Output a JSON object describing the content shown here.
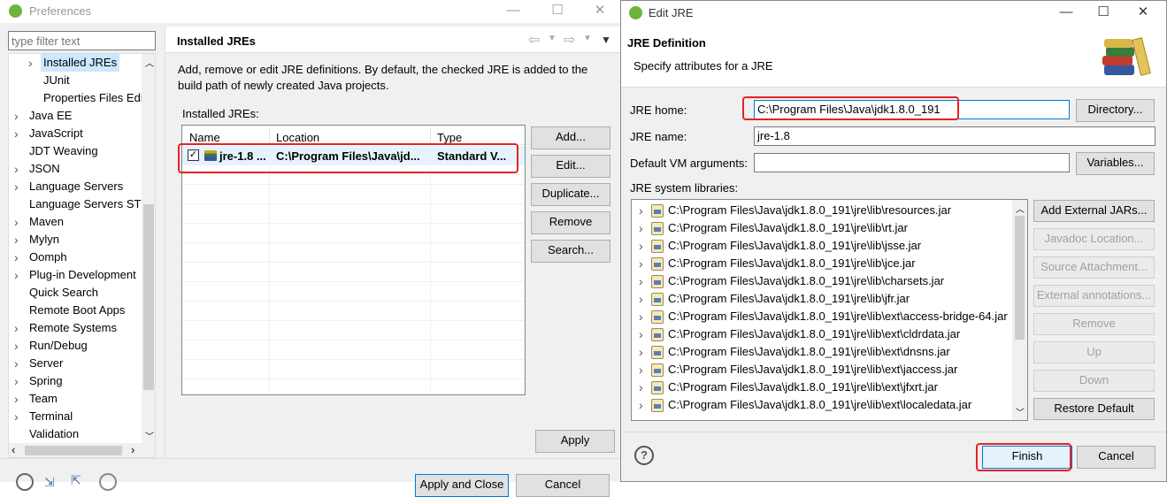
{
  "preferences": {
    "title": "Preferences",
    "filter_placeholder": "type filter text",
    "tree_items": [
      {
        "label": "Installed JREs",
        "expander": "›",
        "selected": true
      },
      {
        "label": "JUnit",
        "expander": "",
        "selected": false
      },
      {
        "label": "Properties Files Edi",
        "expander": "",
        "selected": false
      },
      {
        "label": "Java EE",
        "expander": "›",
        "selected": false
      },
      {
        "label": "JavaScript",
        "expander": "›",
        "selected": false
      },
      {
        "label": "JDT Weaving",
        "expander": "",
        "selected": false
      },
      {
        "label": "JSON",
        "expander": "›",
        "selected": false
      },
      {
        "label": "Language Servers",
        "expander": "›",
        "selected": false
      },
      {
        "label": "Language Servers STS",
        "expander": "",
        "selected": false
      },
      {
        "label": "Maven",
        "expander": "›",
        "selected": false
      },
      {
        "label": "Mylyn",
        "expander": "›",
        "selected": false
      },
      {
        "label": "Oomph",
        "expander": "›",
        "selected": false
      },
      {
        "label": "Plug-in Development",
        "expander": "›",
        "selected": false
      },
      {
        "label": "Quick Search",
        "expander": "",
        "selected": false
      },
      {
        "label": "Remote Boot Apps",
        "expander": "",
        "selected": false
      },
      {
        "label": "Remote Systems",
        "expander": "›",
        "selected": false
      },
      {
        "label": "Run/Debug",
        "expander": "›",
        "selected": false
      },
      {
        "label": "Server",
        "expander": "›",
        "selected": false
      },
      {
        "label": "Spring",
        "expander": "›",
        "selected": false
      },
      {
        "label": "Team",
        "expander": "›",
        "selected": false
      },
      {
        "label": "Terminal",
        "expander": "›",
        "selected": false
      },
      {
        "label": "Validation",
        "expander": "",
        "selected": false
      }
    ],
    "page_title": "Installed JREs",
    "description": "Add, remove or edit JRE definitions. By default, the checked JRE is added to the build path of newly created Java projects.",
    "table_label": "Installed JREs:",
    "table_headers": [
      "Name",
      "Location",
      "Type"
    ],
    "jre_row": {
      "name": "jre-1.8 ...",
      "location": "C:\\Program Files\\Java\\jd...",
      "type": "Standard V...",
      "checked": true
    },
    "buttons": {
      "add": "Add...",
      "edit": "Edit...",
      "duplicate": "Duplicate...",
      "remove": "Remove",
      "search": "Search...",
      "apply": "Apply",
      "apply_close": "Apply and Close",
      "cancel": "Cancel"
    },
    "nav": {
      "back": "⇦",
      "forward": "⇨",
      "menu": "▾"
    }
  },
  "edit_jre": {
    "title": "Edit JRE",
    "header_title": "JRE Definition",
    "header_subtitle": "Specify attributes for a JRE",
    "jre_home_label": "JRE home:",
    "jre_home_value": "C:\\Program Files\\Java\\jdk1.8.0_191",
    "directory_button": "Directory...",
    "jre_name_label": "JRE name:",
    "jre_name_value": "jre-1.8",
    "vm_args_label": "Default VM arguments:",
    "vm_args_value": "",
    "variables_button": "Variables...",
    "libraries_label": "JRE system libraries:",
    "libraries": [
      "C:\\Program Files\\Java\\jdk1.8.0_191\\jre\\lib\\resources.jar",
      "C:\\Program Files\\Java\\jdk1.8.0_191\\jre\\lib\\rt.jar",
      "C:\\Program Files\\Java\\jdk1.8.0_191\\jre\\lib\\jsse.jar",
      "C:\\Program Files\\Java\\jdk1.8.0_191\\jre\\lib\\jce.jar",
      "C:\\Program Files\\Java\\jdk1.8.0_191\\jre\\lib\\charsets.jar",
      "C:\\Program Files\\Java\\jdk1.8.0_191\\jre\\lib\\jfr.jar",
      "C:\\Program Files\\Java\\jdk1.8.0_191\\jre\\lib\\ext\\access-bridge-64.jar",
      "C:\\Program Files\\Java\\jdk1.8.0_191\\jre\\lib\\ext\\cldrdata.jar",
      "C:\\Program Files\\Java\\jdk1.8.0_191\\jre\\lib\\ext\\dnsns.jar",
      "C:\\Program Files\\Java\\jdk1.8.0_191\\jre\\lib\\ext\\jaccess.jar",
      "C:\\Program Files\\Java\\jdk1.8.0_191\\jre\\lib\\ext\\jfxrt.jar",
      "C:\\Program Files\\Java\\jdk1.8.0_191\\jre\\lib\\ext\\localedata.jar"
    ],
    "buttons": {
      "add_external_jars": "Add External JARs...",
      "javadoc_location": "Javadoc Location...",
      "source_attachment": "Source Attachment...",
      "external_annotations": "External annotations...",
      "remove": "Remove",
      "up": "Up",
      "down": "Down",
      "restore_default": "Restore Default",
      "finish": "Finish",
      "cancel": "Cancel"
    }
  },
  "colors": {
    "highlight": "#e52323",
    "selection": "#cce8ff"
  }
}
